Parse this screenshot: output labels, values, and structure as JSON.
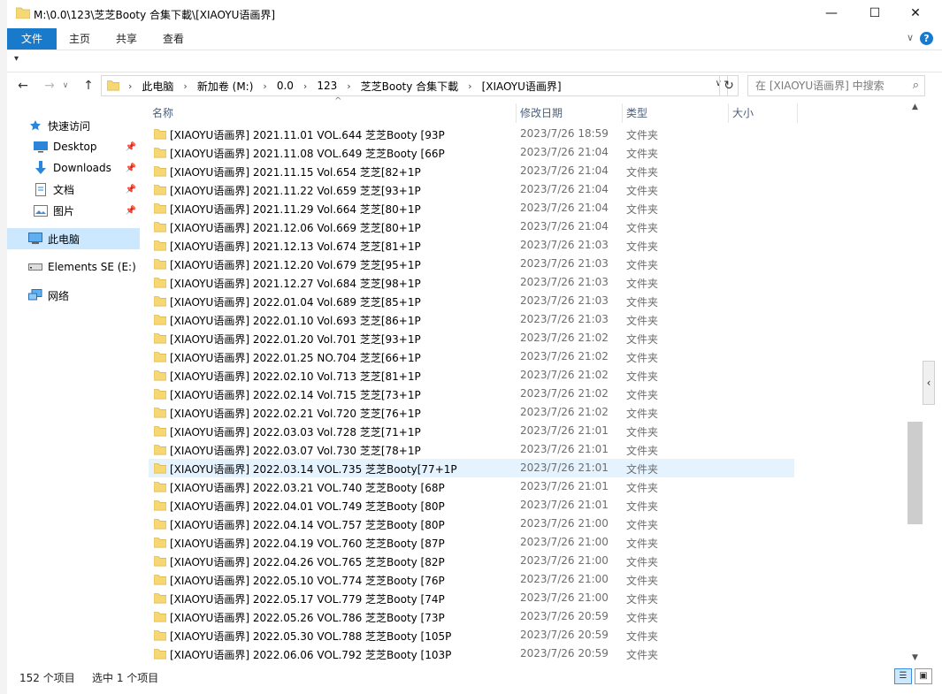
{
  "window": {
    "title": "M:\\0.0\\123\\芝芝Booty 合集下載\\[XIAOYU语画界]",
    "minimize": "—",
    "maximize": "☐",
    "close": "✕"
  },
  "ribbon": {
    "tabs": [
      "文件",
      "主页",
      "共享",
      "查看"
    ]
  },
  "address": {
    "crumbs": [
      "此电脑",
      "新加卷 (M:)",
      "0.0",
      "123",
      "芝芝Booty 合集下載",
      "[XIAOYU语画界]"
    ],
    "search_placeholder": "在 [XIAOYU语画界] 中搜索"
  },
  "nav": {
    "quick_access": "快速访问",
    "items": [
      {
        "label": "Desktop",
        "icon": "desktop-icon"
      },
      {
        "label": "Downloads",
        "icon": "downloads-icon"
      },
      {
        "label": "文档",
        "icon": "documents-icon"
      },
      {
        "label": "图片",
        "icon": "pictures-icon"
      }
    ],
    "this_pc": "此电脑",
    "drive": "Elements SE (E:)",
    "network": "网络"
  },
  "columns": {
    "name": "名称",
    "date": "修改日期",
    "type": "类型",
    "size": "大小"
  },
  "files": [
    {
      "name": "[XIAOYU语画界] 2021.11.01 VOL.644 芝芝Booty [93P",
      "date": "2023/7/26 18:59",
      "type": "文件夹"
    },
    {
      "name": "[XIAOYU语画界] 2021.11.08 VOL.649 芝芝Booty [66P",
      "date": "2023/7/26 21:04",
      "type": "文件夹"
    },
    {
      "name": "[XIAOYU语画界] 2021.11.15 Vol.654 芝芝[82+1P",
      "date": "2023/7/26 21:04",
      "type": "文件夹"
    },
    {
      "name": "[XIAOYU语画界] 2021.11.22 Vol.659 芝芝[93+1P",
      "date": "2023/7/26 21:04",
      "type": "文件夹"
    },
    {
      "name": "[XIAOYU语画界] 2021.11.29 Vol.664 芝芝[80+1P",
      "date": "2023/7/26 21:04",
      "type": "文件夹"
    },
    {
      "name": "[XIAOYU语画界] 2021.12.06 Vol.669 芝芝[80+1P",
      "date": "2023/7/26 21:04",
      "type": "文件夹"
    },
    {
      "name": "[XIAOYU语画界] 2021.12.13 Vol.674 芝芝[81+1P",
      "date": "2023/7/26 21:03",
      "type": "文件夹"
    },
    {
      "name": "[XIAOYU语画界] 2021.12.20 Vol.679 芝芝[95+1P",
      "date": "2023/7/26 21:03",
      "type": "文件夹"
    },
    {
      "name": "[XIAOYU语画界] 2021.12.27 Vol.684 芝芝[98+1P",
      "date": "2023/7/26 21:03",
      "type": "文件夹"
    },
    {
      "name": "[XIAOYU语画界] 2022.01.04 Vol.689 芝芝[85+1P",
      "date": "2023/7/26 21:03",
      "type": "文件夹"
    },
    {
      "name": "[XIAOYU语画界] 2022.01.10 Vol.693 芝芝[86+1P",
      "date": "2023/7/26 21:03",
      "type": "文件夹"
    },
    {
      "name": "[XIAOYU语画界] 2022.01.20 Vol.701 芝芝[93+1P",
      "date": "2023/7/26 21:02",
      "type": "文件夹"
    },
    {
      "name": "[XIAOYU语画界] 2022.01.25 NO.704 芝芝[66+1P",
      "date": "2023/7/26 21:02",
      "type": "文件夹"
    },
    {
      "name": "[XIAOYU语画界] 2022.02.10 Vol.713 芝芝[81+1P",
      "date": "2023/7/26 21:02",
      "type": "文件夹"
    },
    {
      "name": "[XIAOYU语画界] 2022.02.14 Vol.715 芝芝[73+1P",
      "date": "2023/7/26 21:02",
      "type": "文件夹"
    },
    {
      "name": "[XIAOYU语画界] 2022.02.21 Vol.720 芝芝[76+1P",
      "date": "2023/7/26 21:02",
      "type": "文件夹"
    },
    {
      "name": "[XIAOYU语画界] 2022.03.03 Vol.728 芝芝[71+1P",
      "date": "2023/7/26 21:01",
      "type": "文件夹"
    },
    {
      "name": "[XIAOYU语画界] 2022.03.07 Vol.730 芝芝[78+1P",
      "date": "2023/7/26 21:01",
      "type": "文件夹"
    },
    {
      "name": "[XIAOYU语画界] 2022.03.14 VOL.735 芝芝Booty[77+1P",
      "date": "2023/7/26 21:01",
      "type": "文件夹",
      "selected": true
    },
    {
      "name": "[XIAOYU语画界] 2022.03.21 VOL.740 芝芝Booty [68P",
      "date": "2023/7/26 21:01",
      "type": "文件夹"
    },
    {
      "name": "[XIAOYU语画界] 2022.04.01 VOL.749 芝芝Booty [80P",
      "date": "2023/7/26 21:01",
      "type": "文件夹"
    },
    {
      "name": "[XIAOYU语画界] 2022.04.14 VOL.757 芝芝Booty [80P",
      "date": "2023/7/26 21:00",
      "type": "文件夹"
    },
    {
      "name": "[XIAOYU语画界] 2022.04.19 VOL.760 芝芝Booty [87P",
      "date": "2023/7/26 21:00",
      "type": "文件夹"
    },
    {
      "name": "[XIAOYU语画界] 2022.04.26 VOL.765 芝芝Booty [82P",
      "date": "2023/7/26 21:00",
      "type": "文件夹"
    },
    {
      "name": "[XIAOYU语画界] 2022.05.10 VOL.774 芝芝Booty [76P",
      "date": "2023/7/26 21:00",
      "type": "文件夹"
    },
    {
      "name": "[XIAOYU语画界] 2022.05.17 VOL.779 芝芝Booty [74P",
      "date": "2023/7/26 21:00",
      "type": "文件夹"
    },
    {
      "name": "[XIAOYU语画界] 2022.05.26 VOL.786 芝芝Booty [73P",
      "date": "2023/7/26 20:59",
      "type": "文件夹"
    },
    {
      "name": "[XIAOYU语画界] 2022.05.30 VOL.788 芝芝Booty [105P",
      "date": "2023/7/26 20:59",
      "type": "文件夹"
    },
    {
      "name": "[XIAOYU语画界] 2022.06.06 VOL.792 芝芝Booty [103P",
      "date": "2023/7/26 20:59",
      "type": "文件夹"
    }
  ],
  "status": {
    "count": "152 个项目",
    "selection": "选中 1 个项目"
  },
  "colors": {
    "accent": "#1979ca",
    "selection": "#e5f3ff",
    "nav_selected": "#cce8ff",
    "folder": "#f7d774"
  }
}
